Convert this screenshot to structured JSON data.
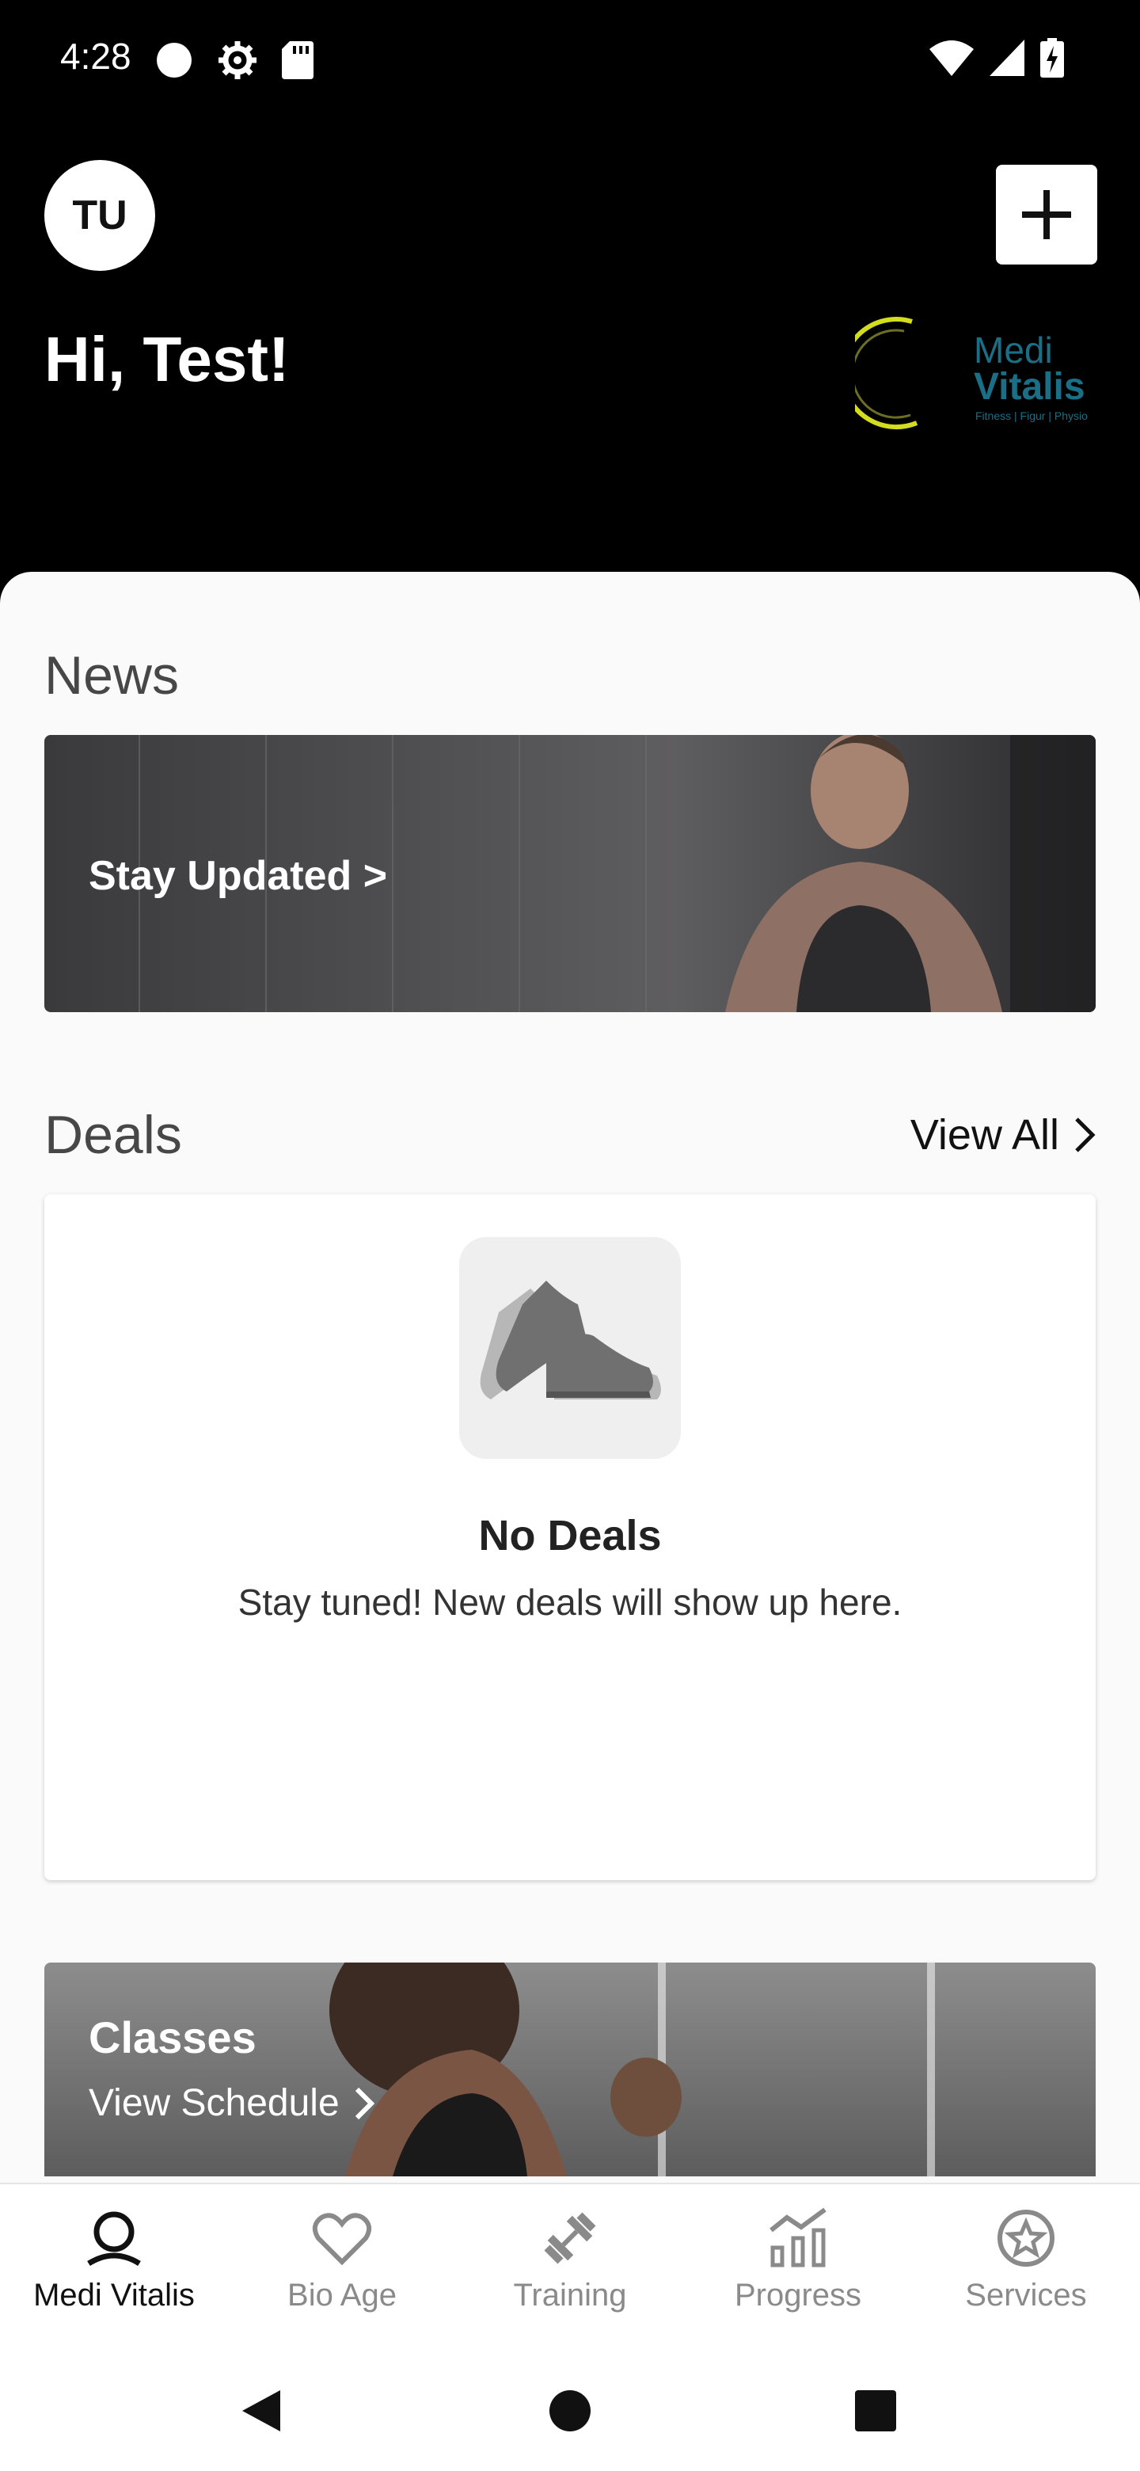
{
  "status_bar": {
    "time": "4:28",
    "left_icons": [
      "circle-icon",
      "gear-icon",
      "sd-card-icon"
    ],
    "right_icons": [
      "wifi-icon",
      "signal-icon",
      "battery-charging-icon"
    ]
  },
  "header": {
    "avatar_initials": "TU",
    "greeting": "Hi, Test!",
    "logo": {
      "word1": "Medi",
      "word2": "Vitalis",
      "tagline": "Fitness | Figur | Physio",
      "ring_color": "#d4dc1e",
      "text_color": "#1a6f86"
    }
  },
  "news": {
    "title": "News",
    "card_text": "Stay Updated >"
  },
  "deals": {
    "title": "Deals",
    "view_all": "View All",
    "empty_title": "No Deals",
    "empty_message": "Stay tuned! New deals will show up here."
  },
  "classes": {
    "title": "Classes",
    "link": "View Schedule"
  },
  "bottom_nav": {
    "items": [
      {
        "label": "Medi Vitalis",
        "icon": "location-person-icon",
        "active": true
      },
      {
        "label": "Bio Age",
        "icon": "heart-icon",
        "active": false
      },
      {
        "label": "Training",
        "icon": "dumbbell-icon",
        "active": false
      },
      {
        "label": "Progress",
        "icon": "chart-icon",
        "active": false
      },
      {
        "label": "Services",
        "icon": "star-badge-icon",
        "active": false
      }
    ]
  },
  "colors": {
    "header_bg": "#000000",
    "sheet_bg": "#fafafa",
    "active_nav": "#111111",
    "inactive_nav": "#8a8a8a"
  }
}
